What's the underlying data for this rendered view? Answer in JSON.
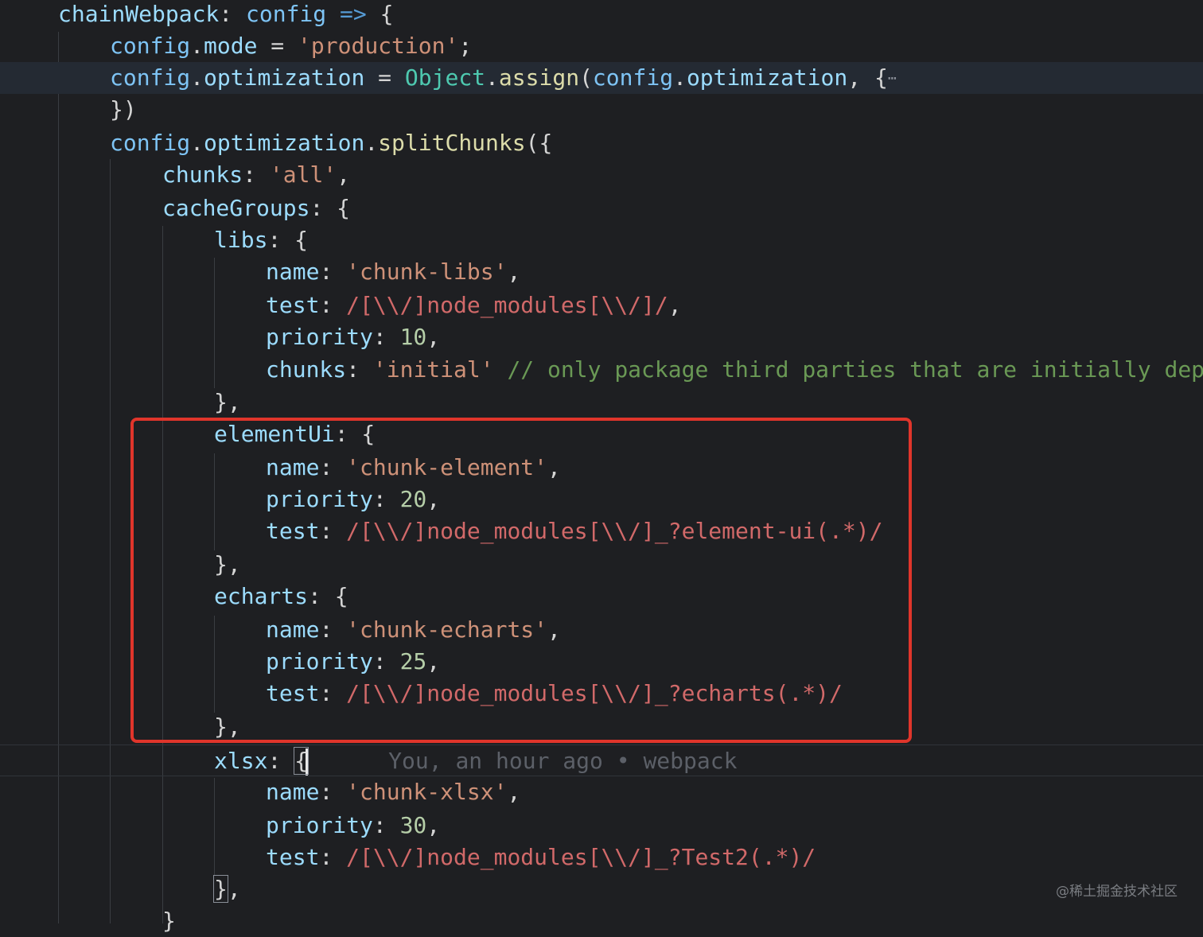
{
  "editor": {
    "lines": [
      {
        "tokens": [
          [
            "prop",
            "chainWebpack"
          ],
          [
            "punc",
            ": "
          ],
          [
            "kw",
            "config"
          ],
          [
            "op",
            " "
          ],
          [
            "arrow",
            "=>"
          ],
          [
            "punc",
            " {"
          ]
        ]
      },
      {
        "tokens": [
          [
            "kw",
            "config"
          ],
          [
            "punc",
            "."
          ],
          [
            "prop",
            "mode"
          ],
          [
            "op",
            " = "
          ],
          [
            "str",
            "'production'"
          ],
          [
            "punc",
            ";"
          ]
        ]
      },
      {
        "tokens": [
          [
            "kw",
            "config"
          ],
          [
            "punc",
            "."
          ],
          [
            "prop",
            "optimization"
          ],
          [
            "op",
            " = "
          ],
          [
            "cls",
            "Object"
          ],
          [
            "punc",
            "."
          ],
          [
            "fn",
            "assign"
          ],
          [
            "punc",
            "("
          ],
          [
            "kw",
            "config"
          ],
          [
            "punc",
            "."
          ],
          [
            "prop",
            "optimization"
          ],
          [
            "punc",
            ", {"
          ],
          [
            "fold",
            "⋯"
          ]
        ]
      },
      {
        "tokens": [
          [
            "punc",
            "})"
          ]
        ]
      },
      {
        "tokens": [
          [
            "kw",
            "config"
          ],
          [
            "punc",
            "."
          ],
          [
            "prop",
            "optimization"
          ],
          [
            "punc",
            "."
          ],
          [
            "fn",
            "splitChunks"
          ],
          [
            "punc",
            "({"
          ]
        ]
      },
      {
        "tokens": [
          [
            "prop",
            "chunks"
          ],
          [
            "punc",
            ": "
          ],
          [
            "str",
            "'all'"
          ],
          [
            "punc",
            ","
          ]
        ]
      },
      {
        "tokens": [
          [
            "prop",
            "cacheGroups"
          ],
          [
            "punc",
            ": {"
          ]
        ]
      },
      {
        "tokens": [
          [
            "prop",
            "libs"
          ],
          [
            "punc",
            ": {"
          ]
        ]
      },
      {
        "tokens": [
          [
            "prop",
            "name"
          ],
          [
            "punc",
            ": "
          ],
          [
            "str",
            "'chunk-libs'"
          ],
          [
            "punc",
            ","
          ]
        ]
      },
      {
        "tokens": [
          [
            "prop",
            "test"
          ],
          [
            "punc",
            ": "
          ],
          [
            "re",
            "/[\\\\/]node_modules[\\\\/]/"
          ],
          [
            "punc",
            ","
          ]
        ]
      },
      {
        "tokens": [
          [
            "prop",
            "priority"
          ],
          [
            "punc",
            ": "
          ],
          [
            "num",
            "10"
          ],
          [
            "punc",
            ","
          ]
        ]
      },
      {
        "tokens": [
          [
            "prop",
            "chunks"
          ],
          [
            "punc",
            ": "
          ],
          [
            "str",
            "'initial'"
          ],
          [
            "op",
            " "
          ],
          [
            "cmt",
            "// only package third parties that are initially depen"
          ]
        ]
      },
      {
        "tokens": [
          [
            "punc",
            "},"
          ]
        ]
      },
      {
        "tokens": [
          [
            "prop",
            "elementUi"
          ],
          [
            "punc",
            ": {"
          ]
        ]
      },
      {
        "tokens": [
          [
            "prop",
            "name"
          ],
          [
            "punc",
            ": "
          ],
          [
            "str",
            "'chunk-element'"
          ],
          [
            "punc",
            ","
          ]
        ]
      },
      {
        "tokens": [
          [
            "prop",
            "priority"
          ],
          [
            "punc",
            ": "
          ],
          [
            "num",
            "20"
          ],
          [
            "punc",
            ","
          ]
        ]
      },
      {
        "tokens": [
          [
            "prop",
            "test"
          ],
          [
            "punc",
            ": "
          ],
          [
            "re",
            "/[\\\\/]node_modules[\\\\/]_?element-ui(.*)/"
          ]
        ]
      },
      {
        "tokens": [
          [
            "punc",
            "},"
          ]
        ]
      },
      {
        "tokens": [
          [
            "prop",
            "echarts"
          ],
          [
            "punc",
            ": {"
          ]
        ]
      },
      {
        "tokens": [
          [
            "prop",
            "name"
          ],
          [
            "punc",
            ": "
          ],
          [
            "str",
            "'chunk-echarts'"
          ],
          [
            "punc",
            ","
          ]
        ]
      },
      {
        "tokens": [
          [
            "prop",
            "priority"
          ],
          [
            "punc",
            ": "
          ],
          [
            "num",
            "25"
          ],
          [
            "punc",
            ","
          ]
        ]
      },
      {
        "tokens": [
          [
            "prop",
            "test"
          ],
          [
            "punc",
            ": "
          ],
          [
            "re",
            "/[\\\\/]node_modules[\\\\/]_?echarts(.*)/"
          ]
        ]
      },
      {
        "tokens": [
          [
            "punc",
            "},"
          ]
        ]
      },
      {
        "tokens": [
          [
            "prop",
            "xlsx"
          ],
          [
            "punc",
            ": "
          ],
          [
            "bracket",
            "{"
          ]
        ]
      },
      {
        "tokens": [
          [
            "prop",
            "name"
          ],
          [
            "punc",
            ": "
          ],
          [
            "str",
            "'chunk-xlsx'"
          ],
          [
            "punc",
            ","
          ]
        ]
      },
      {
        "tokens": [
          [
            "prop",
            "priority"
          ],
          [
            "punc",
            ": "
          ],
          [
            "num",
            "30"
          ],
          [
            "punc",
            ","
          ]
        ]
      },
      {
        "tokens": [
          [
            "prop",
            "test"
          ],
          [
            "punc",
            ": "
          ],
          [
            "re",
            "/[\\\\/]node_modules[\\\\/]_?Test2(.*)/"
          ]
        ]
      },
      {
        "tokens": [
          [
            "bracket",
            "}"
          ],
          [
            "punc",
            ","
          ]
        ]
      },
      {
        "tokens": [
          [
            "punc",
            "}"
          ]
        ]
      }
    ],
    "blame": "You, an hour ago • webpack"
  },
  "watermark": "@稀土掘金技术社区",
  "colors": {
    "background": "#1e1f22",
    "highlight_box": "#e0352b"
  }
}
